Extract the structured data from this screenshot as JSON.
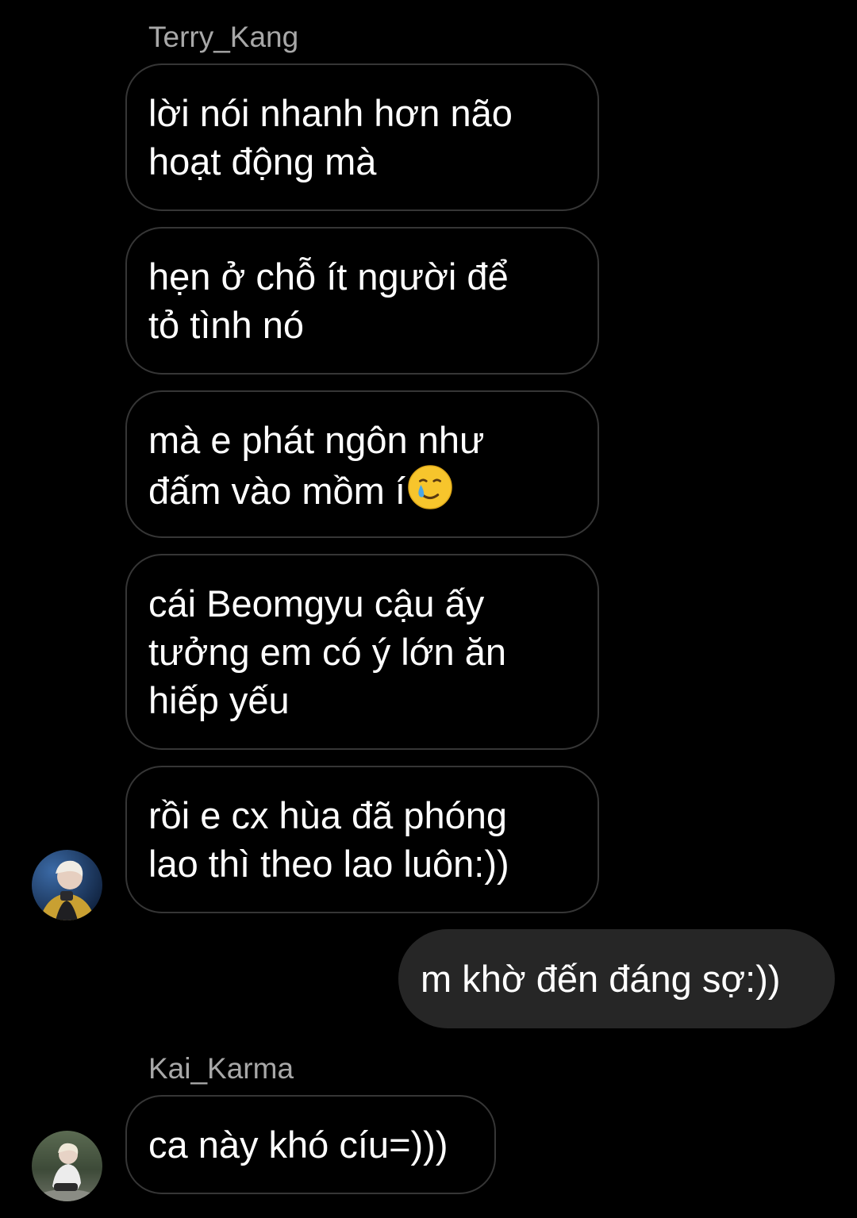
{
  "thread": [
    {
      "sender": "Terry_Kang",
      "messages": [
        {
          "lines": [
            "lời nói nhanh hơn não",
            "hoạt động mà"
          ]
        },
        {
          "lines": [
            "hẹn ở chỗ ít người để",
            "tỏ tình nó"
          ]
        },
        {
          "lines": [
            "mà e phát ngôn như",
            "đấm vào mồm í"
          ],
          "trailing_emoji": "smiling-face-with-tear-emoji"
        },
        {
          "lines": [
            "cái Beomgyu cậu ấy",
            "tưởng em có ý lớn ăn",
            "hiếp yếu"
          ]
        },
        {
          "lines": [
            "rồi e cx hùa đã phóng",
            "lao thì theo lao luôn:))"
          ]
        }
      ]
    },
    {
      "sender": "me",
      "messages": [
        {
          "lines": [
            "m khờ đến đáng sợ:))"
          ]
        }
      ]
    },
    {
      "sender": "Kai_Karma",
      "messages": [
        {
          "lines": [
            "ca này khó cíu=)))"
          ]
        }
      ]
    }
  ],
  "colors": {
    "background": "#000000",
    "incoming_bubble_border": "#363636",
    "outgoing_bubble_fill": "#262626",
    "sender_name": "#a8a8a8",
    "text": "#ffffff"
  }
}
